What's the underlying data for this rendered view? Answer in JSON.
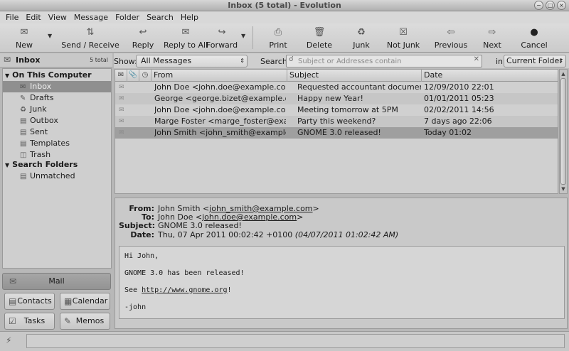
{
  "window": {
    "title": "Inbox (5 total) - Evolution",
    "buttons": [
      "−",
      "□",
      "×"
    ]
  },
  "menubar": [
    "File",
    "Edit",
    "View",
    "Message",
    "Folder",
    "Search",
    "Help"
  ],
  "toolbar": {
    "new": "New",
    "send_receive": "Send / Receive",
    "reply": "Reply",
    "reply_all": "Reply to All",
    "forward": "Forward",
    "print": "Print",
    "delete": "Delete",
    "junk": "Junk",
    "not_junk": "Not Junk",
    "previous": "Previous",
    "next": "Next",
    "cancel": "Cancel"
  },
  "sidebar": {
    "title": "Inbox",
    "count": "5 total",
    "on_this_computer": "On This Computer",
    "folders": [
      {
        "label": "Inbox",
        "icon": "inbox-icon",
        "selected": true
      },
      {
        "label": "Drafts",
        "icon": "drafts-icon"
      },
      {
        "label": "Junk",
        "icon": "junk-icon"
      },
      {
        "label": "Outbox",
        "icon": "outbox-icon"
      },
      {
        "label": "Sent",
        "icon": "sent-icon"
      },
      {
        "label": "Templates",
        "icon": "templates-icon"
      },
      {
        "label": "Trash",
        "icon": "trash-icon"
      }
    ],
    "search_folders": "Search Folders",
    "search_items": [
      {
        "label": "Unmatched",
        "icon": "unmatched-icon"
      }
    ]
  },
  "switcher": {
    "mail": "Mail",
    "contacts": "Contacts",
    "calendar": "Calendar",
    "tasks": "Tasks",
    "memos": "Memos"
  },
  "filter": {
    "show_label": "Show:",
    "show_value": "All Messages",
    "search_label": "Search:",
    "search_placeholder": "Subject or Addresses contain",
    "in_label": "in",
    "scope_value": "Current Folder"
  },
  "columns": {
    "from": "From",
    "subject": "Subject",
    "date": "Date"
  },
  "messages": [
    {
      "from": "John Doe <john.doe@example.com>",
      "subject": "Requested accountant documentation",
      "date": "12/09/2010 22:01"
    },
    {
      "from": "George <george.bizet@example.org>",
      "subject": "Happy new Year!",
      "date": "01/01/2011 05:23"
    },
    {
      "from": "John Doe <john.doe@example.com>",
      "subject": "Meeting tomorrow at 5PM",
      "date": "02/02/2011 14:56"
    },
    {
      "from": "Marge Foster <marge_foster@exampl...",
      "subject": "Party this weekend?",
      "date": "7 days ago 22:06"
    },
    {
      "from": "John Smith <john_smith@example.co...",
      "subject": "GNOME 3.0 released!",
      "date": "Today 01:02"
    }
  ],
  "preview": {
    "from_label": "From:",
    "from_name": "John Smith <",
    "from_email": "john_smith@example.com",
    "from_close": ">",
    "to_label": "To:",
    "to_name": "John Doe <",
    "to_email": "john.doe@example.com",
    "to_close": ">",
    "subject_label": "Subject:",
    "subject": "GNOME 3.0 released!",
    "date_label": "Date:",
    "date": "Thu, 07 Apr 2011 00:02:42 +0100",
    "date_local": "(04/07/2011 01:02:42 AM)",
    "body_greeting": "Hi John,",
    "body_line": "GNOME 3.0 has been released!",
    "body_see": "See ",
    "body_link": "http://www.gnome.org",
    "body_see_end": "!",
    "body_sign": "-john"
  }
}
